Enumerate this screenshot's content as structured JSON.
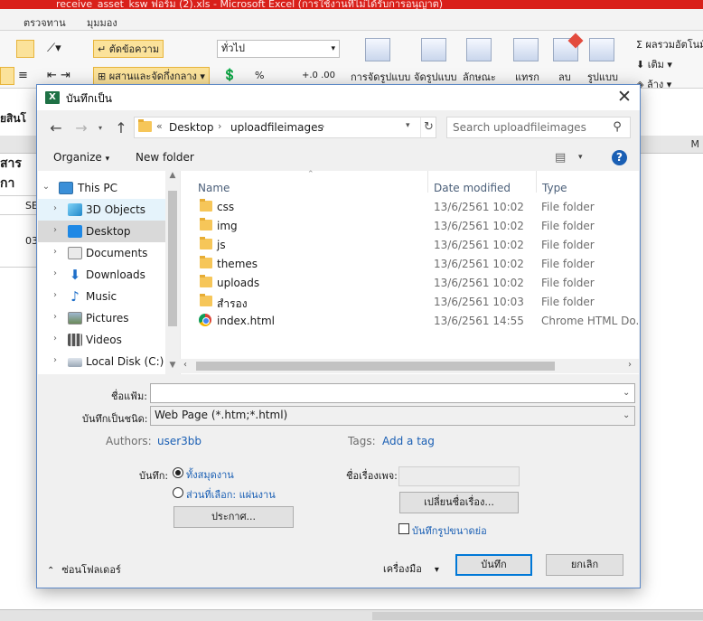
{
  "excel": {
    "title": "receive_asset_ksw ฟอร์ม (2).xls - Microsoft Excel (การใช้งานที่ไม่ได้รับการอนุญาต)",
    "menu": [
      "ตรวจทาน",
      "มุมมอง"
    ],
    "ribbon": {
      "cut": "ตัดข้อความ",
      "merge_center": "ผสานและจัดกึ่งกลาง",
      "number_format": "ทั่วไป",
      "conditional_format": "การจัดรูปแบบ",
      "format_table": "จัดรูปแบบ",
      "cell_styles": "ลักษณะ",
      "insert": "แทรก",
      "delete": "ลบ",
      "format": "รูปแบบ",
      "autosum": "Σ ผลรวมอัตโนมัติ",
      "fill": "เติม",
      "clear": "ล้าง",
      "percent": "%"
    },
    "cells": [
      "ยสินโ",
      "สารกา",
      "SE",
      "03"
    ],
    "col_header_right": "M"
  },
  "dialog": {
    "title": "บันทึกเป็น",
    "close_label": "✕",
    "address": {
      "recent": "«",
      "parts": [
        "Desktop",
        "uploadfileimages"
      ]
    },
    "search_placeholder": "Search uploadfileimages",
    "organize_label": "Organize",
    "new_folder_label": "New folder",
    "help_label": "?",
    "nav_items": [
      {
        "label": "This PC",
        "icon": "computer-icon"
      },
      {
        "label": "3D Objects",
        "icon": "cube-icon"
      },
      {
        "label": "Desktop",
        "icon": "desktop-icon"
      },
      {
        "label": "Documents",
        "icon": "documents-icon"
      },
      {
        "label": "Downloads",
        "icon": "downloads-icon"
      },
      {
        "label": "Music",
        "icon": "music-icon"
      },
      {
        "label": "Pictures",
        "icon": "pictures-icon"
      },
      {
        "label": "Videos",
        "icon": "videos-icon"
      },
      {
        "label": "Local Disk (C:)",
        "icon": "drive-icon"
      }
    ],
    "columns": {
      "name": "Name",
      "date": "Date modified",
      "type": "Type"
    },
    "files": [
      {
        "name": "css",
        "date": "13/6/2561 10:02",
        "type": "File folder",
        "icon": "folder-icon"
      },
      {
        "name": "img",
        "date": "13/6/2561 10:02",
        "type": "File folder",
        "icon": "folder-icon"
      },
      {
        "name": "js",
        "date": "13/6/2561 10:02",
        "type": "File folder",
        "icon": "folder-icon"
      },
      {
        "name": "themes",
        "date": "13/6/2561 10:02",
        "type": "File folder",
        "icon": "folder-icon"
      },
      {
        "name": "uploads",
        "date": "13/6/2561 10:02",
        "type": "File folder",
        "icon": "folder-icon"
      },
      {
        "name": "สำรอง",
        "date": "13/6/2561 10:03",
        "type": "File folder",
        "icon": "folder-icon"
      },
      {
        "name": "index.html",
        "date": "13/6/2561 14:55",
        "type": "Chrome HTML Do...",
        "icon": "chrome-icon"
      }
    ],
    "filename_label": "ชื่อแฟ้ม:",
    "filename_value": "",
    "savetype_label": "บันทึกเป็นชนิด:",
    "savetype_value": "Web Page (*.htm;*.html)",
    "authors_label": "Authors:",
    "authors_value": "user3bb",
    "tags_label": "Tags:",
    "tags_value": "Add a tag",
    "save_label": "บันทึก:",
    "radio_whole": "ทั้งสมุดงาน",
    "radio_selection": "ส่วนที่เลือก: แผ่นงาน",
    "publish_label": "ประกาศ...",
    "page_title_label": "ชื่อเรื่องเพจ:",
    "change_title_label": "เปลี่ยนชื่อเรื่อง...",
    "thumbnail_label": "บันทึกรูปขนาดย่อ",
    "hide_folders_label": "ซ่อนโฟลเดอร์",
    "tools_label": "เครื่องมือ",
    "save_button": "บันทึก",
    "cancel_button": "ยกเลิก"
  }
}
